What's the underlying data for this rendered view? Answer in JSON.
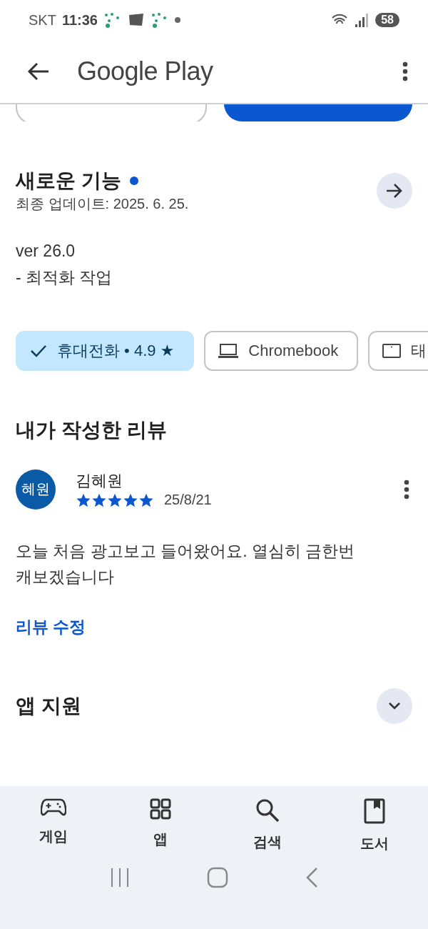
{
  "status_bar": {
    "carrier": "SKT",
    "time": "11:36",
    "battery": "58"
  },
  "app_bar": {
    "title": "Google Play"
  },
  "whats_new": {
    "title": "새로운 기능",
    "updated": "최종 업데이트: 2025. 6. 25.",
    "version": "ver 26.0",
    "notes": "- 최적화 작업"
  },
  "device_chips": [
    {
      "kind": "phone",
      "label": "휴대전화 • 4.9 ★",
      "selected": true
    },
    {
      "kind": "laptop",
      "label": "Chromebook",
      "selected": false
    },
    {
      "kind": "tablet",
      "label": "태",
      "selected": false
    }
  ],
  "my_review": {
    "heading": "내가 작성한 리뷰",
    "avatar": "혜원",
    "author": "김혜원",
    "stars": 5,
    "date": "25/8/21",
    "text": "오늘 처음 광고보고 들어왔어요. 열심히 금한번 캐보겠습니다",
    "edit_link": "리뷰 수정"
  },
  "app_support": {
    "title": "앱 지원",
    "expanded": false
  },
  "bottom_nav": [
    {
      "kind": "games",
      "label": "게임"
    },
    {
      "kind": "apps",
      "label": "앱"
    },
    {
      "kind": "search",
      "label": "검색"
    },
    {
      "kind": "books",
      "label": "도서"
    }
  ]
}
